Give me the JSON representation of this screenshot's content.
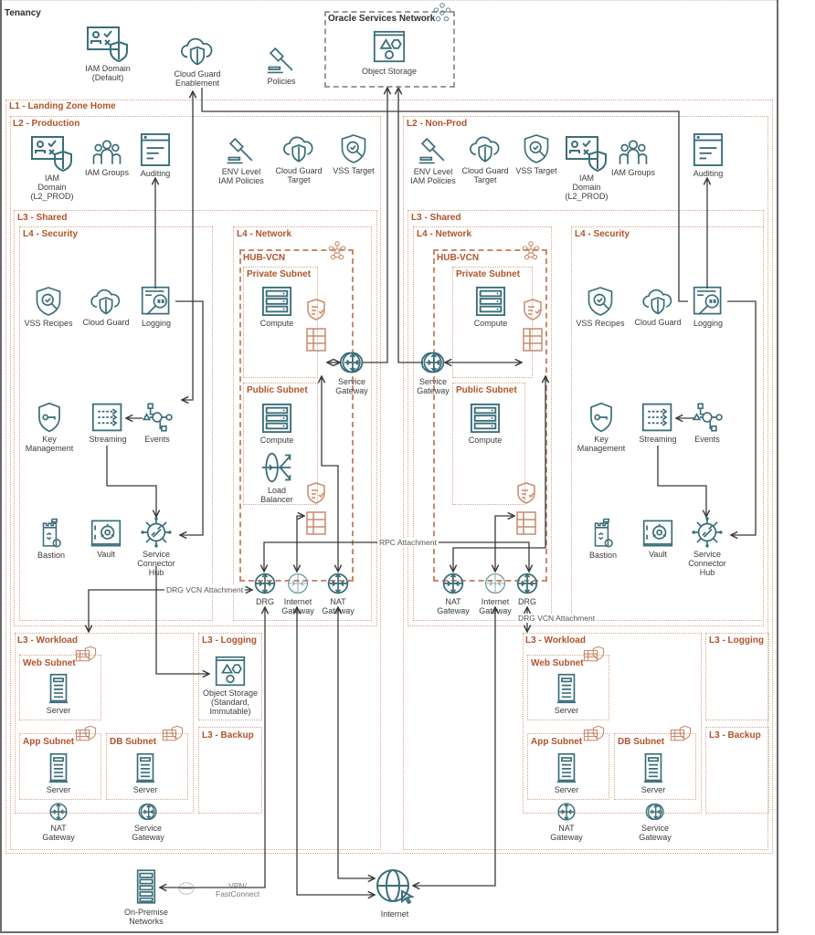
{
  "tenancy": {
    "label": "Tenancy",
    "nodes": {
      "iam_domain_default": "IAM Domain\n(Default)",
      "cloud_guard_enablement": "Cloud Guard\nEnablement",
      "policies": "Policies"
    }
  },
  "osn": {
    "label": "Oracle Services Network",
    "object_storage": "Object Storage"
  },
  "l1": {
    "label": "L1 - Landing Zone Home"
  },
  "production": {
    "label": "L2 - Production",
    "top_nodes": {
      "iam_domain": "IAM\nDomain\n(L2_PROD)",
      "iam_groups": "IAM Groups",
      "auditing": "Auditing",
      "env_policies": "ENV Level\nIAM Policies",
      "cloud_guard_target": "Cloud Guard\nTarget",
      "vss_target": "VSS Target"
    },
    "shared": {
      "label": "L3 - Shared",
      "security": {
        "label": "L4 - Security",
        "vss_recipes": "VSS Recipes",
        "cloud_guard": "Cloud Guard",
        "logging": "Logging",
        "key_management": "Key\nManagement",
        "streaming": "Streaming",
        "events": "Events",
        "bastion": "Bastion",
        "vault": "Vault",
        "sch": "Service\nConnector\nHub"
      },
      "network": {
        "label": "L4 - Network",
        "vcn": "HUB-VCN",
        "private_subnet": "Private Subnet",
        "public_subnet": "Public Subnet",
        "compute_private": "Compute",
        "compute_public": "Compute",
        "load_balancer": "Load\nBalancer",
        "service_gateway": "Service\nGateway",
        "drg": "DRG",
        "internet_gateway": "Internet\nGateway",
        "nat_gateway": "NAT\nGateway"
      }
    },
    "workload": {
      "label": "L3 - Workload",
      "web_subnet": "Web Subnet",
      "app_subnet": "App Subnet",
      "db_subnet": "DB Subnet",
      "server": "Server",
      "nat_gateway": "NAT\nGateway",
      "service_gateway": "Service\nGateway"
    },
    "logging": {
      "label": "L3 - Logging",
      "object_storage": "Object Storage\n(Standard,\nImmutable)"
    },
    "backup": {
      "label": "L3 - Backup"
    }
  },
  "nonprod": {
    "label": "L2 - Non-Prod",
    "top_nodes": {
      "env_policies": "ENV Level\nIAM Policies",
      "cloud_guard_target": "Cloud Guard\nTarget",
      "vss_target": "VSS Target",
      "iam_domain": "IAM\nDomain\n(L2_PROD)",
      "iam_groups": "IAM Groups",
      "auditing": "Auditing"
    },
    "shared": {
      "label": "L3 - Shared",
      "network": {
        "label": "L4 - Network",
        "vcn": "HUB-VCN",
        "private_subnet": "Private Subnet",
        "public_subnet": "Public Subnet",
        "compute_private": "Compute",
        "compute_public": "Compute",
        "service_gateway": "Service\nGateway",
        "nat_gateway": "NAT\nGateway",
        "internet_gateway": "Internet\nGateway",
        "drg": "DRG"
      },
      "security": {
        "label": "L4 - Security",
        "vss_recipes": "VSS Recipes",
        "cloud_guard": "Cloud Guard",
        "logging": "Logging",
        "key_management": "Key\nManagement",
        "streaming": "Streaming",
        "events": "Events",
        "bastion": "Bastion",
        "vault": "Vault",
        "sch": "Service\nConnector\nHub"
      }
    },
    "workload": {
      "label": "L3 - Workload",
      "web_subnet": "Web Subnet",
      "app_subnet": "App Subnet",
      "db_subnet": "DB Subnet",
      "server": "Server",
      "nat_gateway": "NAT\nGateway",
      "service_gateway": "Service\nGateway"
    },
    "logging": {
      "label": "L3 - Logging"
    },
    "backup": {
      "label": "L3 - Backup"
    }
  },
  "edges": {
    "rpc_attachment": "RPC Attachment",
    "drg_vcn_attachment": "DRG VCN Attachment",
    "vpn_fastconnect": "VPN/\nFastConnect"
  },
  "external": {
    "on_premise": "On-Premise\nNetworks",
    "internet": "Internet"
  },
  "colors": {
    "icon_teal": "#3a6e7a",
    "compartment_orange": "#b0532a",
    "connector": "#3a3a3a"
  }
}
